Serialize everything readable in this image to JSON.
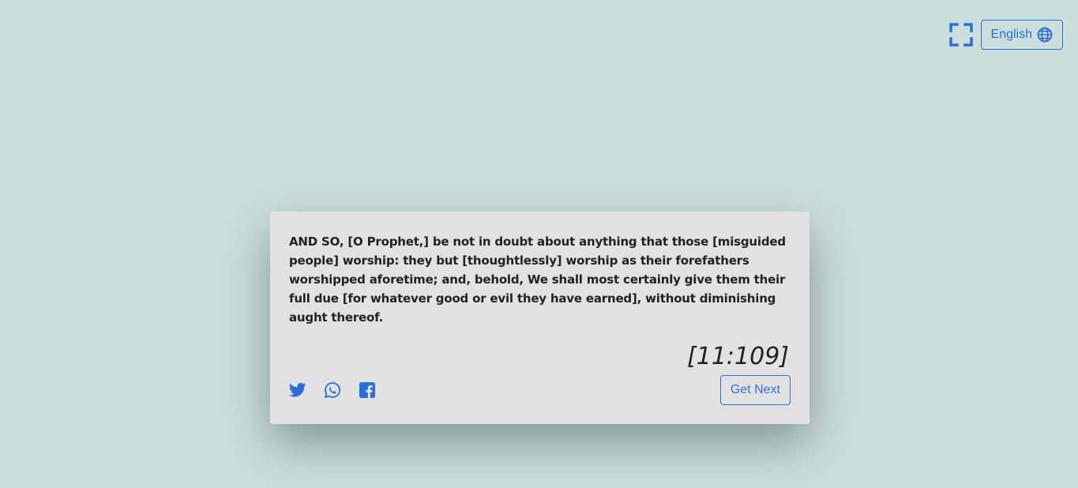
{
  "header": {
    "fullscreen_icon": "fullscreen-icon",
    "language_label": "English",
    "language_icon": "globe-icon"
  },
  "quote": {
    "text": "AND SO, [O Prophet,] be not in doubt about anything that those [misguided people] worship: they but [thoughtlessly] worship as their forefathers worshipped aforetime; and, behold, We shall most certainly give them their full due [for whatever good or evil they have earned], without diminishing aught thereof.",
    "reference": "[11:109]"
  },
  "share": {
    "icons": [
      "twitter-icon",
      "whatsapp-icon",
      "facebook-icon"
    ]
  },
  "actions": {
    "next_label": "Get Next"
  },
  "colors": {
    "background": "#cddfdc",
    "card": "#e2e2e2",
    "accent": "#2a6fd6",
    "text": "#222222"
  }
}
